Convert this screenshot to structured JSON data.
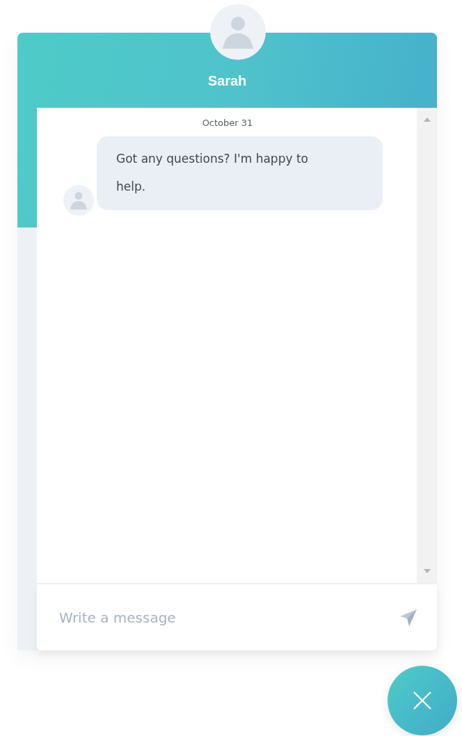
{
  "agent": {
    "name": "Sarah"
  },
  "conversation": {
    "date": "October 31",
    "messages": [
      {
        "text": "Got any questions? I'm happy to help."
      }
    ]
  },
  "composer": {
    "placeholder": "Write a message"
  }
}
